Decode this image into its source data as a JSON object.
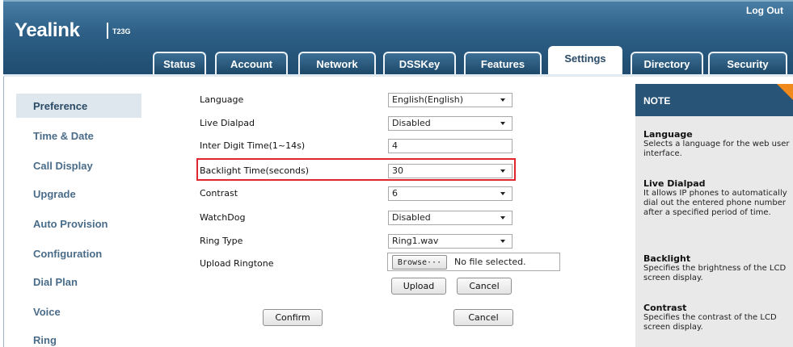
{
  "header": {
    "logo": "Yealink",
    "model": "T23G",
    "logout": "Log Out",
    "tabs": [
      "Status",
      "Account",
      "Network",
      "DSSKey",
      "Features",
      "Settings",
      "Directory",
      "Security"
    ],
    "active_tab": "Settings"
  },
  "sidebar": {
    "items": [
      "Preference",
      "Time & Date",
      "Call Display",
      "Upgrade",
      "Auto Provision",
      "Configuration",
      "Dial Plan",
      "Voice",
      "Ring"
    ],
    "active": "Preference"
  },
  "form": {
    "language_label": "Language",
    "language_value": "English(English)",
    "live_dialpad_label": "Live Dialpad",
    "live_dialpad_value": "Disabled",
    "inter_digit_label": "Inter Digit Time(1~14s)",
    "inter_digit_value": "4",
    "backlight_label": "Backlight Time(seconds)",
    "backlight_value": "30",
    "contrast_label": "Contrast",
    "contrast_value": "6",
    "watchdog_label": "WatchDog",
    "watchdog_value": "Disabled",
    "ring_type_label": "Ring Type",
    "ring_type_value": "Ring1.wav",
    "upload_ringtone_label": "Upload Ringtone",
    "browse_label": "Browse···",
    "no_file_text": "No file selected.",
    "upload_label": "Upload",
    "cancel_small_label": "Cancel",
    "confirm_label": "Confirm",
    "cancel_label": "Cancel"
  },
  "note": {
    "title": "NOTE",
    "sections": [
      {
        "heading": "Language",
        "text": "Selects a language for the web user interface."
      },
      {
        "heading": "Live Dialpad",
        "text": "It allows IP phones to automatically dial out the entered phone number after a specified period of time."
      },
      {
        "heading": "Backlight",
        "text": "Specifies the brightness of the LCD screen display."
      },
      {
        "heading": "Contrast",
        "text": "Specifies the contrast of the LCD screen display."
      }
    ]
  },
  "colors": {
    "header_blue": "#2d5f86",
    "note_header": "#285478",
    "note_accent": "#f08a1c",
    "highlight_red": "#e0262e",
    "sidebar_text": "#4a6c89"
  }
}
